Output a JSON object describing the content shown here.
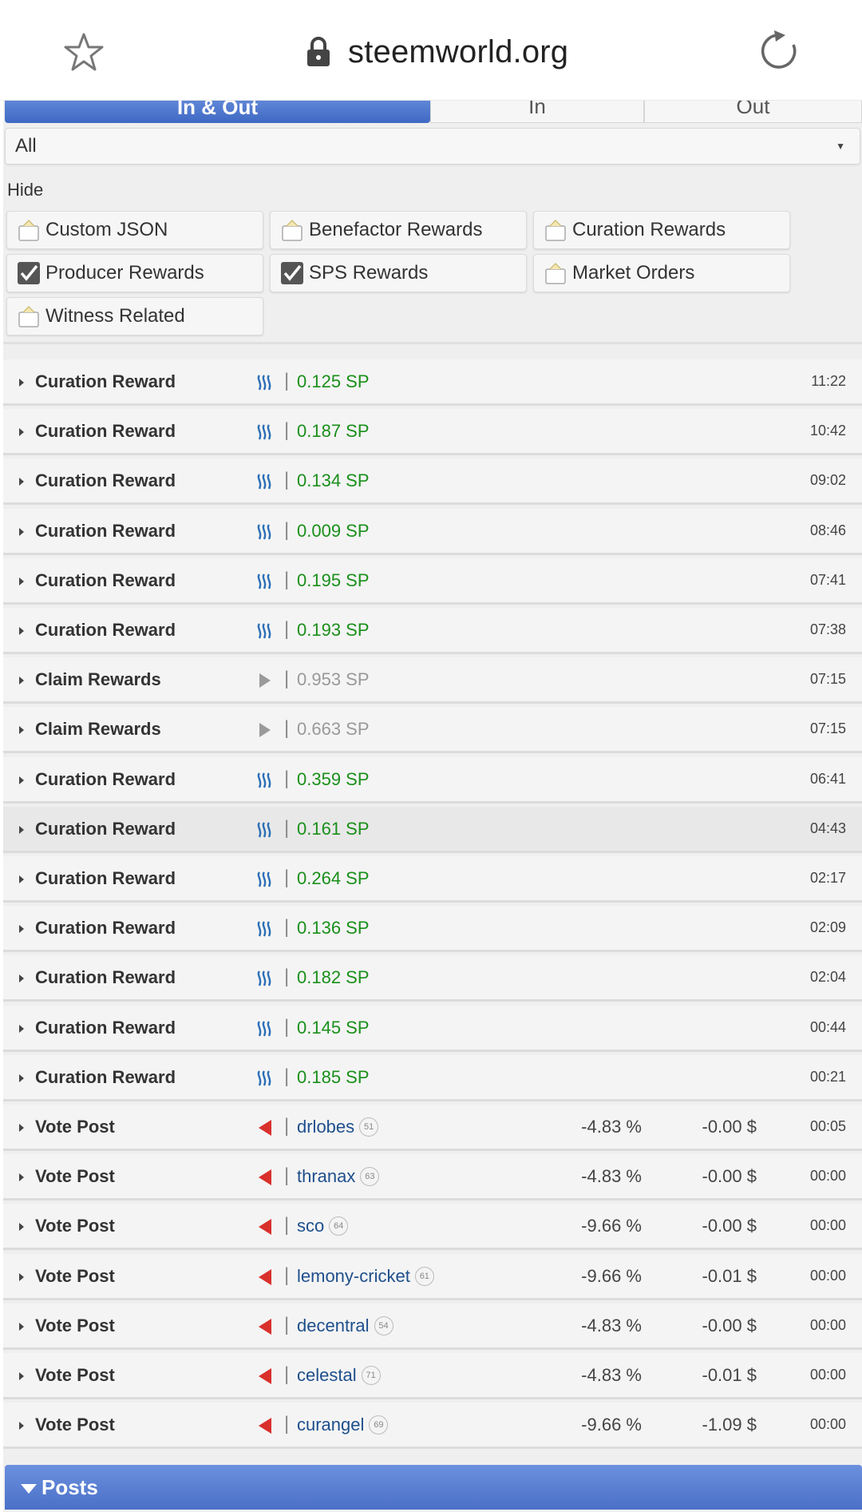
{
  "browser": {
    "domain": "steemworld.org"
  },
  "tabs": [
    {
      "label": "In & Out",
      "active": true
    },
    {
      "label": "In",
      "active": false
    },
    {
      "label": "Out",
      "active": false
    }
  ],
  "filter_select": {
    "value": "All"
  },
  "hide": {
    "label": "Hide",
    "options": [
      {
        "label": "Custom JSON",
        "checked": false
      },
      {
        "label": "Benefactor Rewards",
        "checked": false
      },
      {
        "label": "Curation Rewards",
        "checked": false
      },
      {
        "label": "Producer Rewards",
        "checked": true
      },
      {
        "label": "SPS Rewards",
        "checked": true
      },
      {
        "label": "Market Orders",
        "checked": false
      },
      {
        "label": "Witness Related",
        "checked": false
      }
    ]
  },
  "colors": {
    "accent": "#4a70c8",
    "positive": "#1a8f1a",
    "link": "#1e4f8c",
    "vote": "#d9302c"
  },
  "rows": [
    {
      "type": "Curation Reward",
      "icon": "steem-icon",
      "amount": "0.125 SP",
      "time": "11:22"
    },
    {
      "type": "Curation Reward",
      "icon": "steem-icon",
      "amount": "0.187 SP",
      "time": "10:42"
    },
    {
      "type": "Curation Reward",
      "icon": "steem-icon",
      "amount": "0.134 SP",
      "time": "09:02"
    },
    {
      "type": "Curation Reward",
      "icon": "steem-icon",
      "amount": "0.009 SP",
      "time": "08:46"
    },
    {
      "type": "Curation Reward",
      "icon": "steem-icon",
      "amount": "0.195 SP",
      "time": "07:41"
    },
    {
      "type": "Curation Reward",
      "icon": "steem-icon",
      "amount": "0.193 SP",
      "time": "07:38"
    },
    {
      "type": "Claim Rewards",
      "icon": "play-icon",
      "amount": "0.953 SP",
      "time": "07:15"
    },
    {
      "type": "Claim Rewards",
      "icon": "play-icon",
      "amount": "0.663 SP",
      "time": "07:15"
    },
    {
      "type": "Curation Reward",
      "icon": "steem-icon",
      "amount": "0.359 SP",
      "time": "06:41"
    },
    {
      "type": "Curation Reward",
      "icon": "steem-icon",
      "amount": "0.161 SP",
      "time": "04:43"
    },
    {
      "type": "Curation Reward",
      "icon": "steem-icon",
      "amount": "0.264 SP",
      "time": "02:17"
    },
    {
      "type": "Curation Reward",
      "icon": "steem-icon",
      "amount": "0.136 SP",
      "time": "02:09"
    },
    {
      "type": "Curation Reward",
      "icon": "steem-icon",
      "amount": "0.182 SP",
      "time": "02:04"
    },
    {
      "type": "Curation Reward",
      "icon": "steem-icon",
      "amount": "0.145 SP",
      "time": "00:44"
    },
    {
      "type": "Curation Reward",
      "icon": "steem-icon",
      "amount": "0.185 SP",
      "time": "00:21"
    },
    {
      "type": "Vote Post",
      "icon": "vote-icon",
      "user": "drlobes",
      "rep": "51",
      "percent": "-4.83 %",
      "usd": "-0.00 $",
      "time": "00:05"
    },
    {
      "type": "Vote Post",
      "icon": "vote-icon",
      "user": "thranax",
      "rep": "63",
      "percent": "-4.83 %",
      "usd": "-0.00 $",
      "time": "00:00"
    },
    {
      "type": "Vote Post",
      "icon": "vote-icon",
      "user": "sco",
      "rep": "64",
      "percent": "-9.66 %",
      "usd": "-0.00 $",
      "time": "00:00"
    },
    {
      "type": "Vote Post",
      "icon": "vote-icon",
      "user": "lemony-cricket",
      "rep": "61",
      "percent": "-9.66 %",
      "usd": "-0.01 $",
      "time": "00:00"
    },
    {
      "type": "Vote Post",
      "icon": "vote-icon",
      "user": "decentral",
      "rep": "54",
      "percent": "-4.83 %",
      "usd": "-0.00 $",
      "time": "00:00"
    },
    {
      "type": "Vote Post",
      "icon": "vote-icon",
      "user": "celestal",
      "rep": "71",
      "percent": "-4.83 %",
      "usd": "-0.01 $",
      "time": "00:00"
    },
    {
      "type": "Vote Post",
      "icon": "vote-icon",
      "user": "curangel",
      "rep": "69",
      "percent": "-9.66 %",
      "usd": "-1.09 $",
      "time": "00:00"
    }
  ],
  "posts_section": {
    "label": "Posts"
  }
}
